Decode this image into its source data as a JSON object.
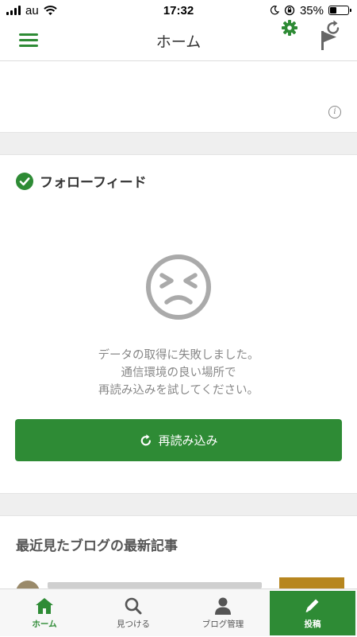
{
  "status_bar": {
    "carrier": "au",
    "time": "17:32",
    "battery_percent": "35%",
    "battery_level": 0.35
  },
  "nav": {
    "title": "ホーム",
    "left_icon": "hamburger-menu-icon",
    "right_icon": "flag-icon"
  },
  "feed": {
    "title": "フォローフィード",
    "error_lines": [
      "データの取得に失敗しました。",
      "通信環境の良い場所で",
      "再読み込みを試してください。"
    ],
    "reload_label": "再読み込み"
  },
  "recent": {
    "title": "最近見たブログの最新記事"
  },
  "tabs": [
    {
      "label": "ホーム",
      "icon": "home-icon",
      "active": true
    },
    {
      "label": "見つける",
      "icon": "search-icon",
      "active": false
    },
    {
      "label": "ブログ管理",
      "icon": "person-icon",
      "active": false
    },
    {
      "label": "投稿",
      "icon": "pencil-icon",
      "active": false
    }
  ],
  "colors": {
    "accent": "#2e8b35",
    "separator": "#efefef",
    "muted_text": "#888888"
  }
}
